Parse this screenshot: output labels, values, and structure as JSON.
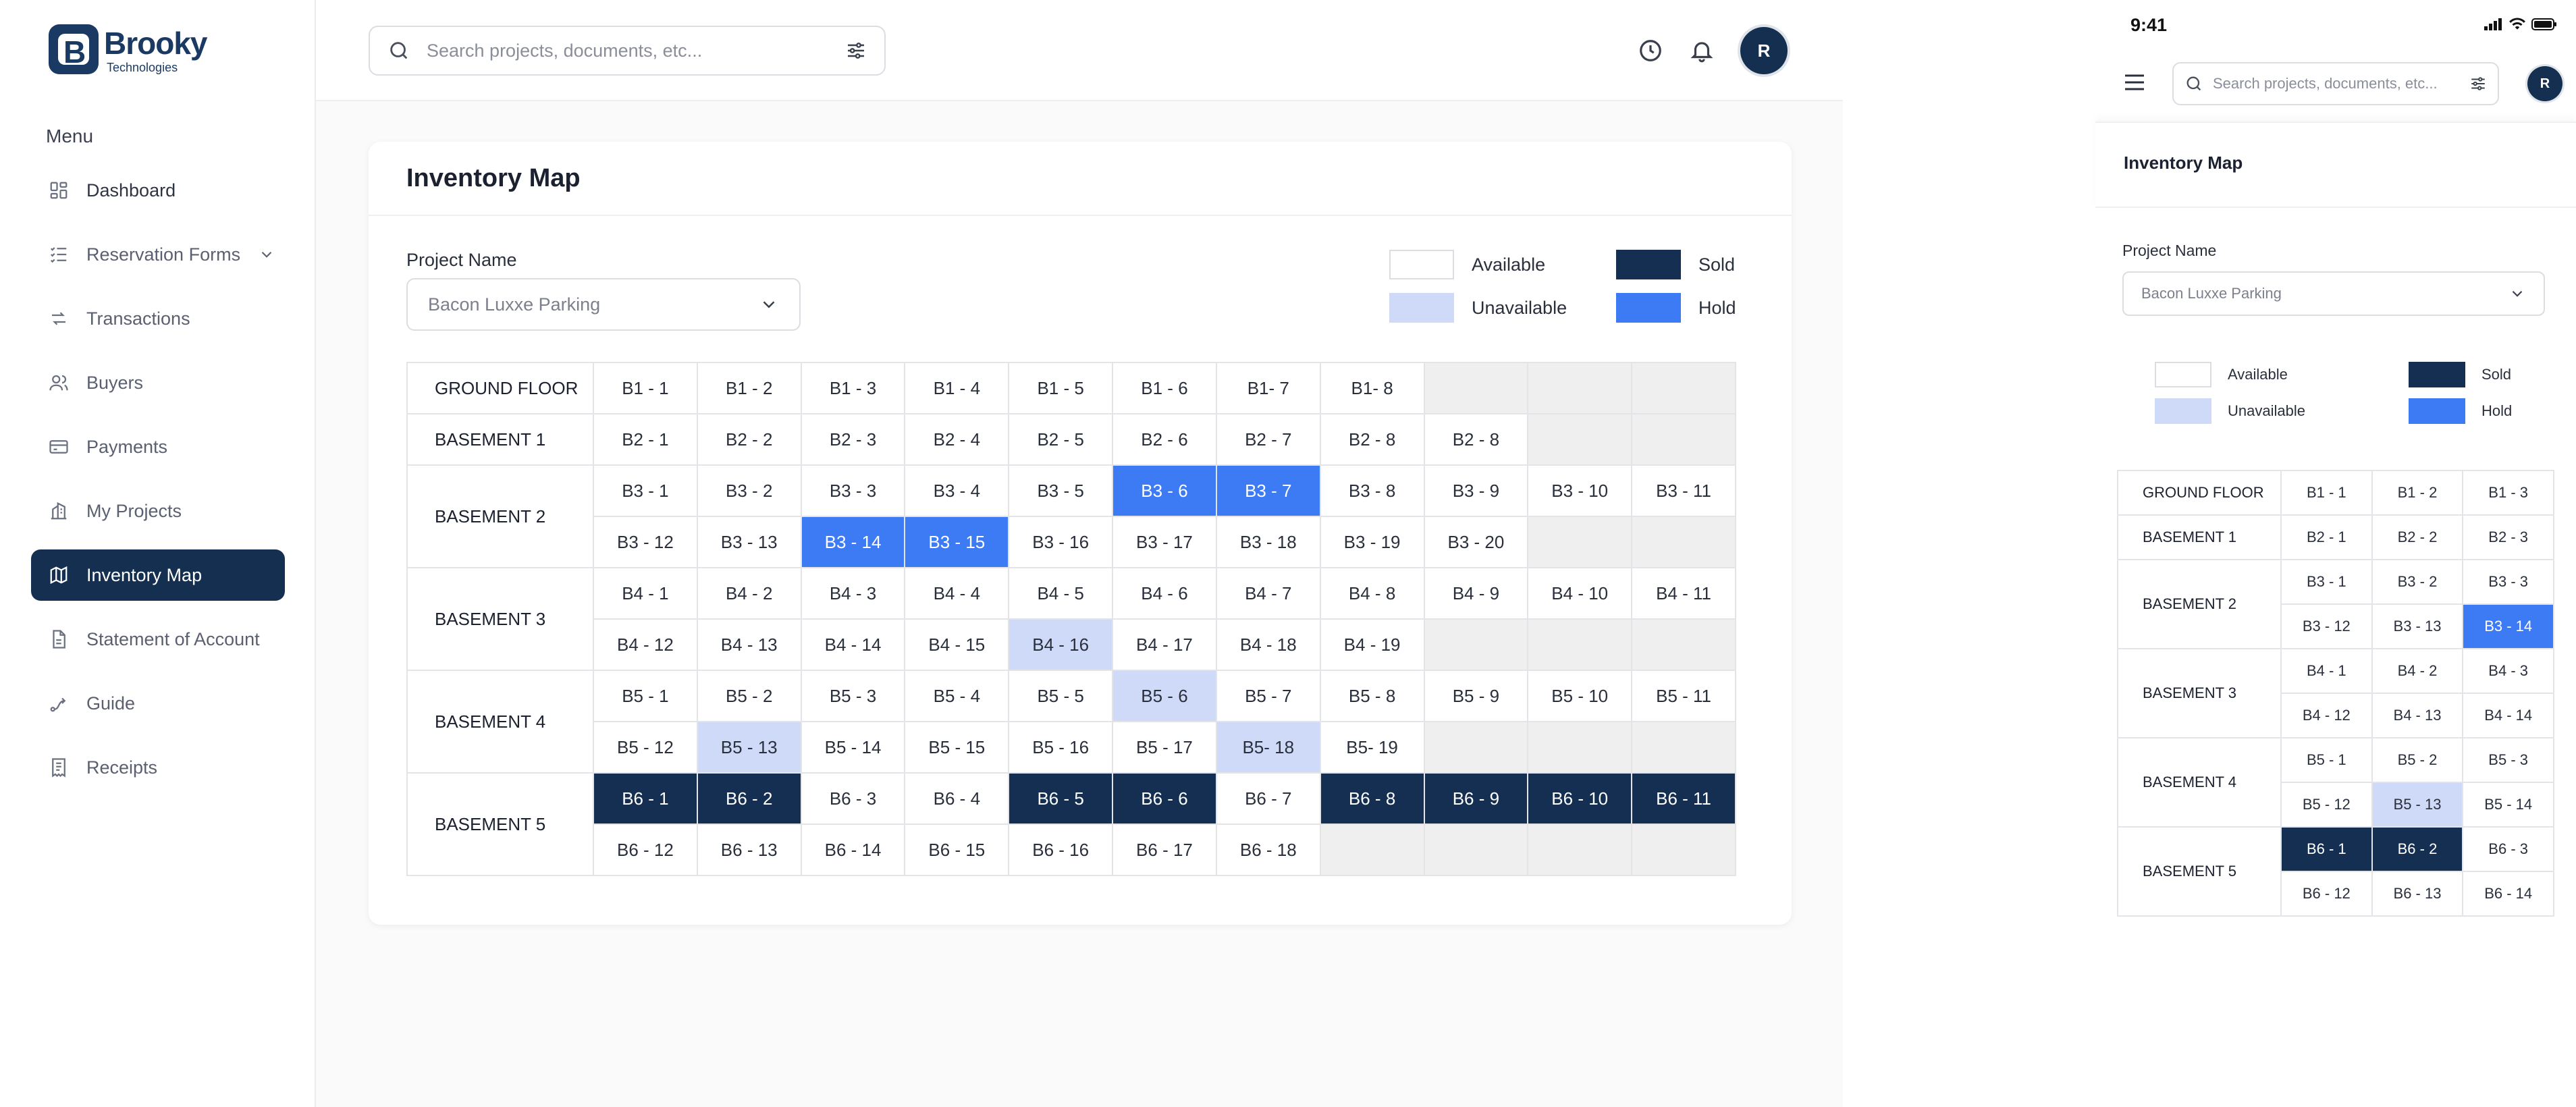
{
  "brand": {
    "name": "Brooky",
    "tagline": "Technologies",
    "mark": "B"
  },
  "sidebar": {
    "menu_label": "Menu",
    "items": [
      {
        "label": "Dashboard",
        "icon": "dashboard-icon"
      },
      {
        "label": "Reservation Forms",
        "icon": "checklist-icon",
        "has_submenu": true
      },
      {
        "label": "Transactions",
        "icon": "transfer-icon"
      },
      {
        "label": "Buyers",
        "icon": "users-icon"
      },
      {
        "label": "Payments",
        "icon": "card-icon"
      },
      {
        "label": "My Projects",
        "icon": "building-icon"
      },
      {
        "label": "Inventory Map",
        "icon": "map-icon",
        "active": true
      },
      {
        "label": "Statement of Account",
        "icon": "document-icon"
      },
      {
        "label": "Guide",
        "icon": "route-icon"
      },
      {
        "label": "Receipts",
        "icon": "receipt-icon"
      }
    ]
  },
  "header": {
    "search_placeholder": "Search projects, documents, etc...",
    "avatar_initial": "R"
  },
  "page": {
    "title": "Inventory Map",
    "project_label": "Project Name",
    "project_value": "Bacon Luxxe Parking"
  },
  "legend": {
    "available": "Available",
    "unavailable": "Unavailable",
    "sold": "Sold",
    "hold": "Hold"
  },
  "colors": {
    "sold": "#142f51",
    "hold": "#3d7bf5",
    "unavailable": "#cfdaf8",
    "empty": "#efefef",
    "active_nav": "#152f50"
  },
  "inventory": {
    "floors": [
      {
        "name": "GROUND FLOOR",
        "rows": [
          [
            [
              "B1 - 1",
              "a"
            ],
            [
              "B1 - 2",
              "a"
            ],
            [
              "B1 - 3",
              "a"
            ],
            [
              "B1 - 4",
              "a"
            ],
            [
              "B1 - 5",
              "a"
            ],
            [
              "B1 - 6",
              "a"
            ],
            [
              "B1- 7",
              "a"
            ],
            [
              "B1- 8",
              "a"
            ],
            [
              "",
              "e"
            ],
            [
              "",
              "e"
            ],
            [
              "",
              "e"
            ]
          ]
        ]
      },
      {
        "name": "BASEMENT 1",
        "rows": [
          [
            [
              "B2 - 1",
              "a"
            ],
            [
              "B2 - 2",
              "a"
            ],
            [
              "B2 - 3",
              "a"
            ],
            [
              "B2 - 4",
              "a"
            ],
            [
              "B2 - 5",
              "a"
            ],
            [
              "B2 - 6",
              "a"
            ],
            [
              "B2 - 7",
              "a"
            ],
            [
              "B2 - 8",
              "a"
            ],
            [
              "B2 - 8",
              "a"
            ],
            [
              "",
              "e"
            ],
            [
              "",
              "e"
            ]
          ]
        ]
      },
      {
        "name": "BASEMENT 2",
        "rows": [
          [
            [
              "B3 - 1",
              "a"
            ],
            [
              "B3 - 2",
              "a"
            ],
            [
              "B3 - 3",
              "a"
            ],
            [
              "B3 - 4",
              "a"
            ],
            [
              "B3 - 5",
              "a"
            ],
            [
              "B3 - 6",
              "h"
            ],
            [
              "B3 - 7",
              "h"
            ],
            [
              "B3 - 8",
              "a"
            ],
            [
              "B3 - 9",
              "a"
            ],
            [
              "B3 - 10",
              "a"
            ],
            [
              "B3 - 11",
              "a"
            ]
          ],
          [
            [
              "B3 - 12",
              "a"
            ],
            [
              "B3 - 13",
              "a"
            ],
            [
              "B3 - 14",
              "h"
            ],
            [
              "B3 - 15",
              "h"
            ],
            [
              "B3 - 16",
              "a"
            ],
            [
              "B3 - 17",
              "a"
            ],
            [
              "B3 - 18",
              "a"
            ],
            [
              "B3 - 19",
              "a"
            ],
            [
              "B3 - 20",
              "a"
            ],
            [
              "",
              "e"
            ],
            [
              "",
              "e"
            ]
          ]
        ]
      },
      {
        "name": "BASEMENT 3",
        "rows": [
          [
            [
              "B4 - 1",
              "a"
            ],
            [
              "B4 - 2",
              "a"
            ],
            [
              "B4 - 3",
              "a"
            ],
            [
              "B4 - 4",
              "a"
            ],
            [
              "B4 - 5",
              "a"
            ],
            [
              "B4 - 6",
              "a"
            ],
            [
              "B4 - 7",
              "a"
            ],
            [
              "B4 - 8",
              "a"
            ],
            [
              "B4 - 9",
              "a"
            ],
            [
              "B4 - 10",
              "a"
            ],
            [
              "B4 - 11",
              "a"
            ]
          ],
          [
            [
              "B4 - 12",
              "a"
            ],
            [
              "B4 - 13",
              "a"
            ],
            [
              "B4 - 14",
              "a"
            ],
            [
              "B4 - 15",
              "a"
            ],
            [
              "B4 - 16",
              "u"
            ],
            [
              "B4 - 17",
              "a"
            ],
            [
              "B4 - 18",
              "a"
            ],
            [
              "B4 - 19",
              "a"
            ],
            [
              "",
              "e"
            ],
            [
              "",
              "e"
            ],
            [
              "",
              "e"
            ]
          ]
        ]
      },
      {
        "name": "BASEMENT 4",
        "rows": [
          [
            [
              "B5 - 1",
              "a"
            ],
            [
              "B5 - 2",
              "a"
            ],
            [
              "B5 - 3",
              "a"
            ],
            [
              "B5 - 4",
              "a"
            ],
            [
              "B5 - 5",
              "a"
            ],
            [
              "B5 - 6",
              "u"
            ],
            [
              "B5 - 7",
              "a"
            ],
            [
              "B5 - 8",
              "a"
            ],
            [
              "B5 - 9",
              "a"
            ],
            [
              "B5 - 10",
              "a"
            ],
            [
              "B5 - 11",
              "a"
            ]
          ],
          [
            [
              "B5 - 12",
              "a"
            ],
            [
              "B5 - 13",
              "u"
            ],
            [
              "B5 - 14",
              "a"
            ],
            [
              "B5 - 15",
              "a"
            ],
            [
              "B5 - 16",
              "a"
            ],
            [
              "B5 - 17",
              "a"
            ],
            [
              "B5- 18",
              "u"
            ],
            [
              "B5- 19",
              "a"
            ],
            [
              "",
              "e"
            ],
            [
              "",
              "e"
            ],
            [
              "",
              "e"
            ]
          ]
        ]
      },
      {
        "name": "BASEMENT 5",
        "rows": [
          [
            [
              "B6 - 1",
              "s"
            ],
            [
              "B6 - 2",
              "s"
            ],
            [
              "B6 - 3",
              "a"
            ],
            [
              "B6 - 4",
              "a"
            ],
            [
              "B6 - 5",
              "s"
            ],
            [
              "B6 - 6",
              "s"
            ],
            [
              "B6 - 7",
              "a"
            ],
            [
              "B6 - 8",
              "s"
            ],
            [
              "B6 - 9",
              "s"
            ],
            [
              "B6 - 10",
              "s"
            ],
            [
              "B6 - 11",
              "s"
            ]
          ],
          [
            [
              "B6 - 12",
              "a"
            ],
            [
              "B6 - 13",
              "a"
            ],
            [
              "B6 - 14",
              "a"
            ],
            [
              "B6 - 15",
              "a"
            ],
            [
              "B6 - 16",
              "a"
            ],
            [
              "B6 - 17",
              "a"
            ],
            [
              "B6 - 18",
              "a"
            ],
            [
              "",
              "e"
            ],
            [
              "",
              "e"
            ],
            [
              "",
              "e"
            ],
            [
              "",
              "e"
            ]
          ]
        ]
      }
    ]
  },
  "mobile": {
    "time": "9:41",
    "search_placeholder": "Search projects, documents, etc...",
    "avatar_initial": "R",
    "title": "Inventory Map",
    "project_label": "Project Name",
    "project_value": "Bacon Luxxe Parking",
    "floors": [
      {
        "name": "GROUND FLOOR",
        "rows": [
          [
            [
              "B1 - 1",
              "a"
            ],
            [
              "B1 - 2",
              "a"
            ],
            [
              "B1 - 3",
              "a"
            ]
          ]
        ]
      },
      {
        "name": "BASEMENT 1",
        "rows": [
          [
            [
              "B2 - 1",
              "a"
            ],
            [
              "B2 - 2",
              "a"
            ],
            [
              "B2 - 3",
              "a"
            ]
          ]
        ]
      },
      {
        "name": "BASEMENT 2",
        "rows": [
          [
            [
              "B3 - 1",
              "a"
            ],
            [
              "B3 - 2",
              "a"
            ],
            [
              "B3 - 3",
              "a"
            ]
          ],
          [
            [
              "B3 - 12",
              "a"
            ],
            [
              "B3 - 13",
              "a"
            ],
            [
              "B3 - 14",
              "h"
            ]
          ]
        ]
      },
      {
        "name": "BASEMENT 3",
        "rows": [
          [
            [
              "B4 - 1",
              "a"
            ],
            [
              "B4 - 2",
              "a"
            ],
            [
              "B4 - 3",
              "a"
            ]
          ],
          [
            [
              "B4 - 12",
              "a"
            ],
            [
              "B4 - 13",
              "a"
            ],
            [
              "B4 - 14",
              "a"
            ]
          ]
        ]
      },
      {
        "name": "BASEMENT 4",
        "rows": [
          [
            [
              "B5 - 1",
              "a"
            ],
            [
              "B5 - 2",
              "a"
            ],
            [
              "B5 - 3",
              "a"
            ]
          ],
          [
            [
              "B5 - 12",
              "a"
            ],
            [
              "B5 - 13",
              "u"
            ],
            [
              "B5 - 14",
              "a"
            ]
          ]
        ]
      },
      {
        "name": "BASEMENT 5",
        "rows": [
          [
            [
              "B6 - 1",
              "s"
            ],
            [
              "B6 - 2",
              "s"
            ],
            [
              "B6 - 3",
              "a"
            ]
          ],
          [
            [
              "B6 - 12",
              "a"
            ],
            [
              "B6 - 13",
              "a"
            ],
            [
              "B6 - 14",
              "a"
            ]
          ]
        ]
      }
    ]
  }
}
